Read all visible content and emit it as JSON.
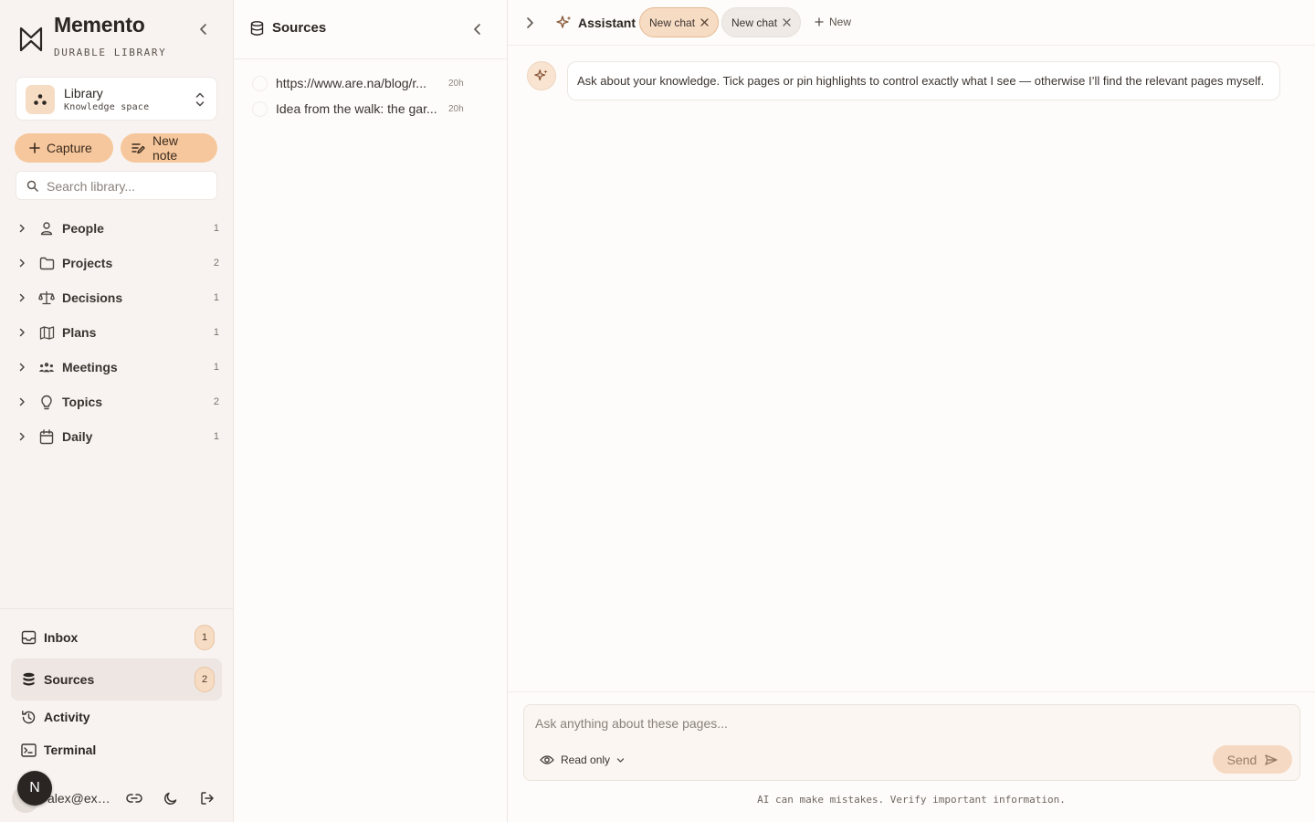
{
  "brand": {
    "title": "Memento",
    "subtitle": "DURABLE LIBRARY"
  },
  "workspace": {
    "name": "Library",
    "type": "Knowledge space"
  },
  "actions": {
    "capture_label": "Capture",
    "new_note_label": "New note"
  },
  "search": {
    "placeholder": "Search library..."
  },
  "categories": [
    {
      "label": "People",
      "count": "1",
      "icon": "person-icon"
    },
    {
      "label": "Projects",
      "count": "2",
      "icon": "folder-icon"
    },
    {
      "label": "Decisions",
      "count": "1",
      "icon": "scale-icon"
    },
    {
      "label": "Plans",
      "count": "1",
      "icon": "map-icon"
    },
    {
      "label": "Meetings",
      "count": "1",
      "icon": "users-icon"
    },
    {
      "label": "Topics",
      "count": "2",
      "icon": "lightbulb-icon"
    },
    {
      "label": "Daily",
      "count": "1",
      "icon": "calendar-icon"
    }
  ],
  "nav": {
    "inbox": {
      "label": "Inbox",
      "count": "1"
    },
    "sources": {
      "label": "Sources",
      "count": "2"
    },
    "activity": {
      "label": "Activity"
    },
    "terminal": {
      "label": "Terminal"
    }
  },
  "user": {
    "initial": "N",
    "email": "alex@example.com"
  },
  "sources_panel": {
    "title": "Sources",
    "items": [
      {
        "title": "https://www.are.na/blog/r...",
        "time": "20h"
      },
      {
        "title": "Idea from the walk: the gar...",
        "time": "20h"
      }
    ]
  },
  "assistant": {
    "title": "Assistant",
    "tabs": [
      {
        "label": "New chat",
        "active": true
      },
      {
        "label": "New chat",
        "active": false
      }
    ],
    "new_label": "New",
    "intro_message": "Ask about your knowledge. Tick pages or pin highlights to control exactly what I see — otherwise I’ll find the relevant pages myself.",
    "composer_placeholder": "Ask anything about these pages...",
    "mode_label": "Read only",
    "send_label": "Send",
    "disclaimer": "AI can make mistakes. Verify important information."
  },
  "colors": {
    "accent": "#f6c79c",
    "accent_soft": "#f7dcc4",
    "sidebar_bg": "#f8f3f0",
    "icon_brown": "#8a5a3a"
  }
}
